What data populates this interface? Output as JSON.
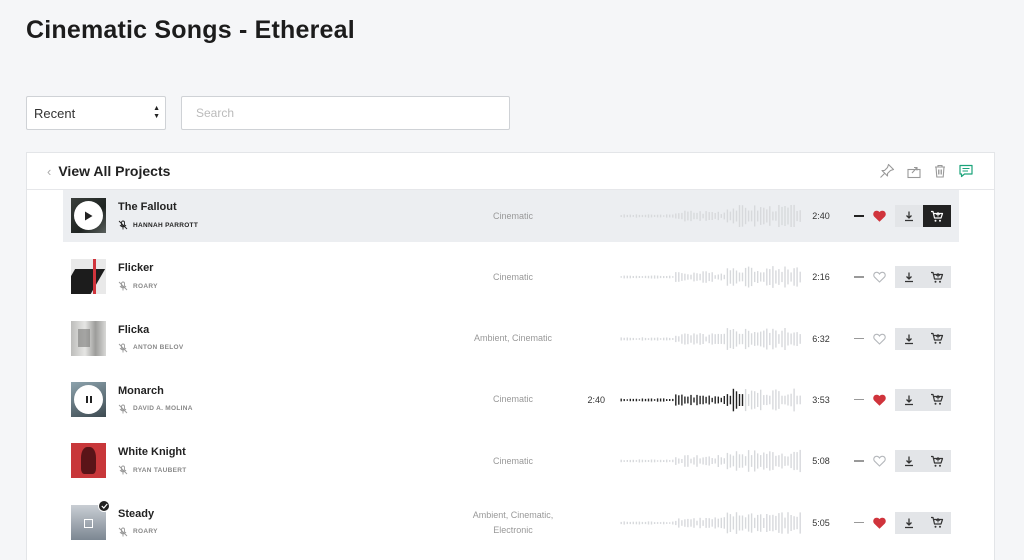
{
  "page": {
    "title": "Cinematic Songs - Ethereal"
  },
  "controls": {
    "sort_value": "Recent",
    "search_placeholder": "Search"
  },
  "panel": {
    "back_label": "View All Projects",
    "header_icons": [
      "pin-icon",
      "share-icon",
      "trash-icon",
      "comment-icon"
    ]
  },
  "colors": {
    "heart_filled": "#d0343c",
    "heart_empty": "#b5b8bc",
    "comment_accent": "#1aa37a",
    "cart_active_bg": "#222222",
    "button_bg": "#e3e5e8"
  },
  "tracks": [
    {
      "title": "The Fallout",
      "artist": "HANNAH PARROTT",
      "genre_lines": [
        "Cinematic"
      ],
      "elapsed": "",
      "duration": "2:40",
      "liked": true,
      "state": "hover",
      "checked": false,
      "art": "fallout",
      "cart_active": true
    },
    {
      "title": "Flicker",
      "artist": "ROARY",
      "genre_lines": [
        "Cinematic"
      ],
      "elapsed": "",
      "duration": "2:16",
      "liked": false,
      "state": "none",
      "checked": false,
      "art": "flicker",
      "cart_active": false
    },
    {
      "title": "Flicka",
      "artist": "ANTON BELOV",
      "genre_lines": [
        "Ambient,    Cinematic"
      ],
      "elapsed": "",
      "duration": "6:32",
      "liked": false,
      "state": "none",
      "checked": false,
      "art": "flicka",
      "cart_active": false
    },
    {
      "title": "Monarch",
      "artist": "DAVID A. MOLINA",
      "genre_lines": [
        "Cinematic"
      ],
      "elapsed": "2:40",
      "duration": "3:53",
      "liked": true,
      "state": "playing",
      "checked": false,
      "art": "monarch",
      "cart_active": false,
      "progress": 0.68
    },
    {
      "title": "White Knight",
      "artist": "RYAN TAUBERT",
      "genre_lines": [
        "Cinematic"
      ],
      "elapsed": "",
      "duration": "5:08",
      "liked": false,
      "state": "none",
      "checked": false,
      "art": "knight",
      "cart_active": false
    },
    {
      "title": "Steady",
      "artist": "ROARY",
      "genre_lines": [
        "Ambient,    Cinematic,",
        "Electronic"
      ],
      "elapsed": "",
      "duration": "5:05",
      "liked": true,
      "state": "none",
      "checked": true,
      "art": "steady",
      "cart_active": false
    }
  ]
}
